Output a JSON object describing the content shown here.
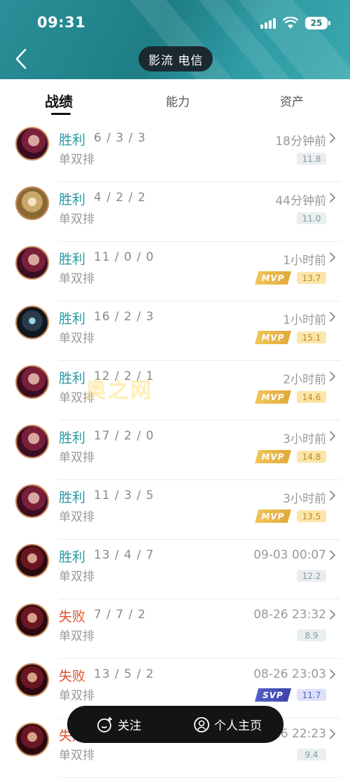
{
  "status_bar": {
    "time": "09:31",
    "battery": "25"
  },
  "header": {
    "server": "影流 电信"
  },
  "tabs": [
    "战绩",
    "能力",
    "资产"
  ],
  "watermark": "奥之网",
  "matches": [
    {
      "result": "胜利",
      "outcome": "win",
      "kda": "6 / 3 / 3",
      "mode": "单双排",
      "time": "18分钟前",
      "score": "11.8",
      "score_style": "grey",
      "badge": "",
      "avatar": "champion-avatar-red-hair"
    },
    {
      "result": "胜利",
      "outcome": "win",
      "kda": "4 / 2 / 2",
      "mode": "单双排",
      "time": "44分钟前",
      "score": "11.0",
      "score_style": "grey",
      "badge": "",
      "avatar": "champion-avatar-gold-helmet"
    },
    {
      "result": "胜利",
      "outcome": "win",
      "kda": "11 / 0 / 0",
      "mode": "单双排",
      "time": "1小时前",
      "score": "13.7",
      "score_style": "gold",
      "badge": "MVP",
      "avatar": "champion-avatar-red-hair"
    },
    {
      "result": "胜利",
      "outcome": "win",
      "kda": "16 / 2 / 3",
      "mode": "单双排",
      "time": "1小时前",
      "score": "15.1",
      "score_style": "gold",
      "badge": "MVP",
      "avatar": "champion-avatar-dark-cloak"
    },
    {
      "result": "胜利",
      "outcome": "win",
      "kda": "12 / 2 / 1",
      "mode": "单双排",
      "time": "2小时前",
      "score": "14.6",
      "score_style": "gold",
      "badge": "MVP",
      "avatar": "champion-avatar-red-hair"
    },
    {
      "result": "胜利",
      "outcome": "win",
      "kda": "17 / 2 / 0",
      "mode": "单双排",
      "time": "3小时前",
      "score": "14.8",
      "score_style": "gold",
      "badge": "MVP",
      "avatar": "champion-avatar-red-hair"
    },
    {
      "result": "胜利",
      "outcome": "win",
      "kda": "11 / 3 / 5",
      "mode": "单双排",
      "time": "3小时前",
      "score": "13.5",
      "score_style": "gold",
      "badge": "MVP",
      "avatar": "champion-avatar-red-hair"
    },
    {
      "result": "胜利",
      "outcome": "win",
      "kda": "13 / 4 / 7",
      "mode": "单双排",
      "time": "09-03 00:07",
      "score": "12.2",
      "score_style": "grey",
      "badge": "",
      "avatar": "champion-avatar-dark-red"
    },
    {
      "result": "失败",
      "outcome": "loss",
      "kda": "7 / 7 / 2",
      "mode": "单双排",
      "time": "08-26 23:32",
      "score": "8.9",
      "score_style": "grey",
      "badge": "",
      "avatar": "champion-avatar-dark-red"
    },
    {
      "result": "失败",
      "outcome": "loss",
      "kda": "13 / 5 / 2",
      "mode": "单双排",
      "time": "08-26 23:03",
      "score": "11.7",
      "score_style": "blue",
      "badge": "SVP",
      "avatar": "champion-avatar-dark-red"
    },
    {
      "result": "失败",
      "outcome": "loss",
      "kda": "",
      "mode": "单双排",
      "time": "08-26 22:23",
      "score": "9.4",
      "score_style": "grey",
      "badge": "",
      "avatar": "champion-avatar-dark-red"
    }
  ],
  "bottom_bar": {
    "follow": "关注",
    "profile": "个人主页"
  },
  "colors": {
    "win": "#2a9aa6",
    "loss": "#e0522e",
    "header": "#1f7e86"
  }
}
